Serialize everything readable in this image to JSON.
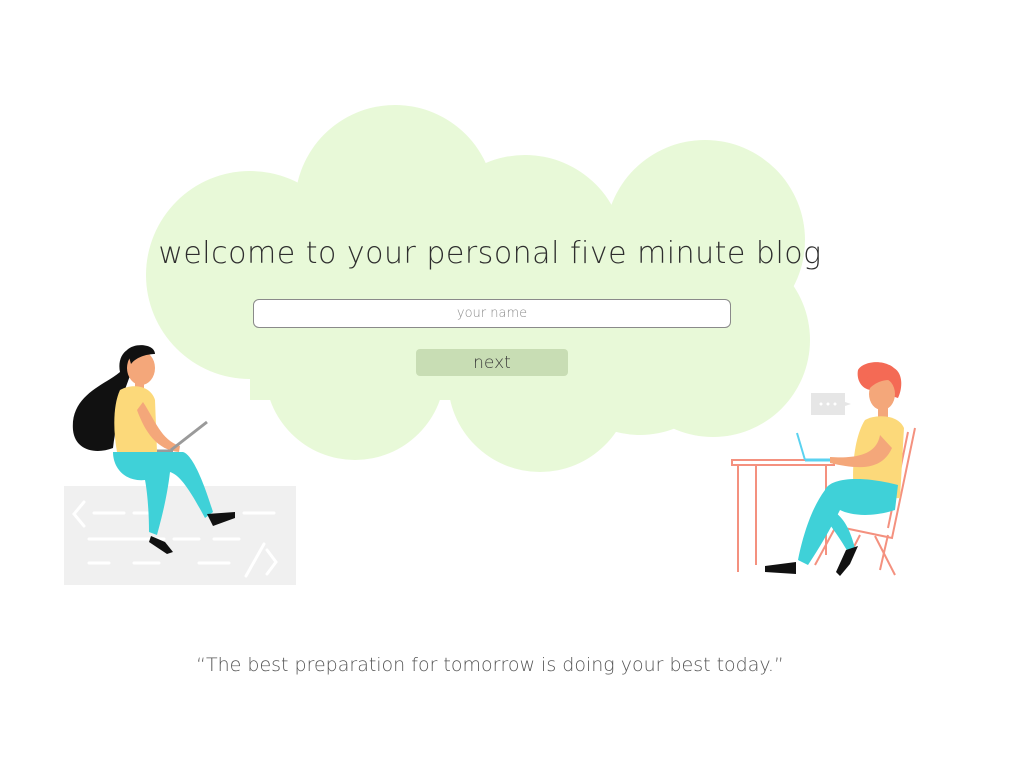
{
  "colors": {
    "cloud": "#e8f9d8",
    "next_button": "#c8ddb4",
    "skin": "#f4a77a",
    "shirt": "#fcd97a",
    "pants": "#3fd1d8",
    "hair_woman": "#111111",
    "hair_man": "#f46a55",
    "desk": "#f4917f"
  },
  "welcome": {
    "title": "welcome to your personal five minute blog"
  },
  "form": {
    "name_placeholder": "your name",
    "name_value": "",
    "next_label": "next"
  },
  "illustrations": {
    "left_icon": "woman-laptop-illustration",
    "right_icon": "man-desk-illustration",
    "chat_icon": "chat-bubble-icon",
    "code_icon": "code-card-icon"
  },
  "footer": {
    "quote": "“The best preparation for tomorrow is doing your best today.”"
  }
}
